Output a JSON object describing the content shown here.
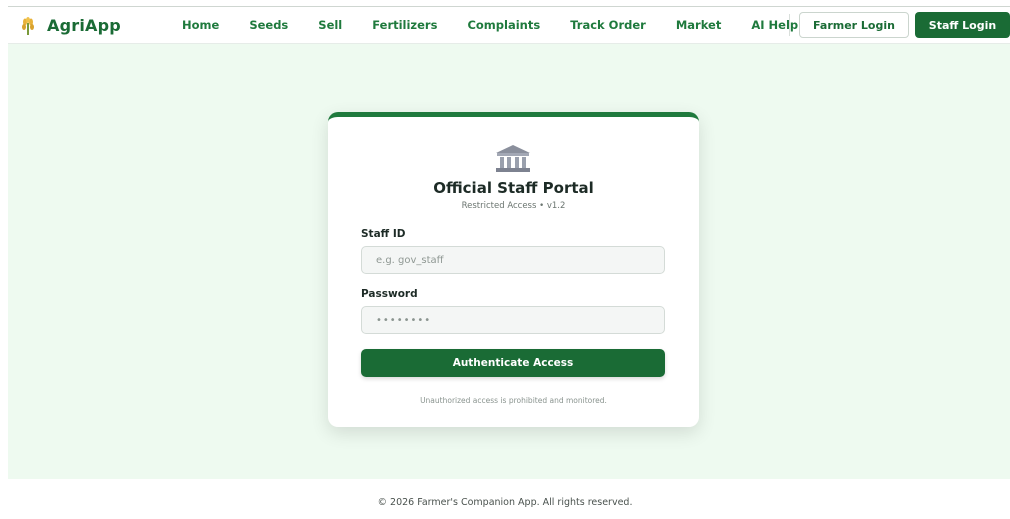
{
  "brand": {
    "name": "AgriApp",
    "icon": "wheat-icon"
  },
  "nav": {
    "links": [
      "Home",
      "Seeds",
      "Sell",
      "Fertilizers",
      "Complaints",
      "Track Order",
      "Market",
      "AI Help"
    ],
    "farmer_login": "Farmer Login",
    "staff_login": "Staff Login"
  },
  "card": {
    "icon": "bank-icon",
    "title": "Official Staff Portal",
    "subtitle": "Restricted Access • v1.2",
    "staff_id_label": "Staff ID",
    "staff_id_placeholder": "e.g. gov_staff",
    "password_label": "Password",
    "password_value": "••••••••",
    "submit_label": "Authenticate Access",
    "notice": "Unauthorized access is prohibited and monitored."
  },
  "footer": {
    "text": "© 2026 Farmer's Companion App. All rights reserved."
  },
  "colors": {
    "primary": "#1a6b35",
    "background": "#eefaf0"
  }
}
